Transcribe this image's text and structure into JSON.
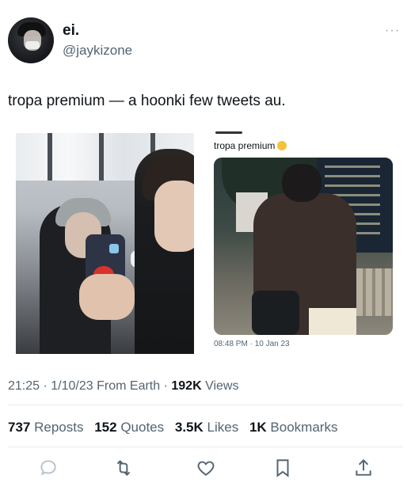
{
  "author": {
    "name": "ei.",
    "handle": "@jaykizone"
  },
  "more_menu": "···",
  "tweet_text": "tropa premium — a hoonki few tweets au.",
  "quoted_card": {
    "title": "tropa premium",
    "timestamp": "08:48 PM · 10 Jan 23"
  },
  "meta": {
    "time": "21:25",
    "date": "1/10/23",
    "source": "From Earth",
    "views_count": "192K",
    "views_label": "Views"
  },
  "stats": {
    "reposts_count": "737",
    "reposts_label": "Reposts",
    "quotes_count": "152",
    "quotes_label": "Quotes",
    "likes_count": "3.5K",
    "likes_label": "Likes",
    "bookmarks_count": "1K",
    "bookmarks_label": "Bookmarks"
  },
  "actions": [
    "reply-icon",
    "retweet-icon",
    "like-icon",
    "bookmark-icon",
    "share-icon"
  ]
}
